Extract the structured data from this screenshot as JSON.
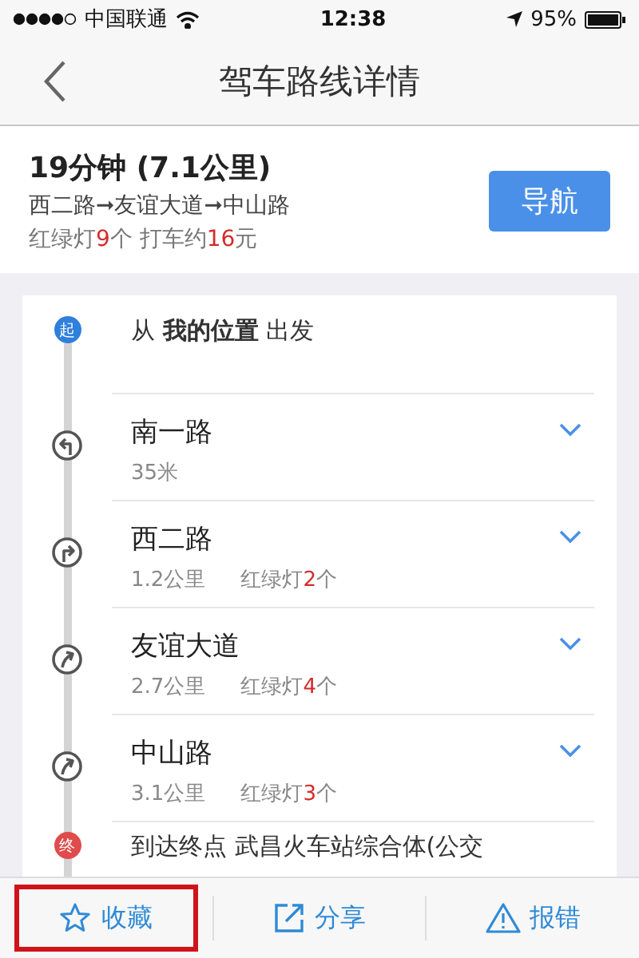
{
  "status_bar": {
    "carrier": "中国联通",
    "time": "12:38",
    "battery": "95%"
  },
  "nav": {
    "title": "驾车路线详情"
  },
  "summary": {
    "duration": "19分钟 (7.1公里)",
    "route": "西二路➞友谊大道➞中山路",
    "info": [
      {
        "text": "红绿灯",
        "highlight": false
      },
      {
        "text": "9",
        "highlight": true
      },
      {
        "text": "个 打车约",
        "highlight": false
      },
      {
        "text": "16",
        "highlight": true
      },
      {
        "text": "元",
        "highlight": false
      }
    ],
    "button": "导航"
  },
  "steps": [
    {
      "kind": "start",
      "badge": "起",
      "text": "从 **我的位置** 出发"
    },
    {
      "kind": "left",
      "road": "南一路",
      "distance": "35米",
      "expandable": true
    },
    {
      "kind": "right",
      "road": "西二路",
      "distance": "1.2公里",
      "lights": [
        {
          "text": "红绿灯",
          "highlight": false
        },
        {
          "text": "2",
          "highlight": true
        },
        {
          "text": "个",
          "highlight": false
        }
      ],
      "expandable": true
    },
    {
      "kind": "bear-right",
      "road": "友谊大道",
      "distance": "2.7公里",
      "lights": [
        {
          "text": "红绿灯",
          "highlight": false
        },
        {
          "text": "4",
          "highlight": true
        },
        {
          "text": "个",
          "highlight": false
        }
      ],
      "expandable": true
    },
    {
      "kind": "bear-right",
      "road": "中山路",
      "distance": "3.1公里",
      "lights": [
        {
          "text": "红绿灯",
          "highlight": false
        },
        {
          "text": "3",
          "highlight": true
        },
        {
          "text": "个",
          "highlight": false
        }
      ],
      "expandable": true
    },
    {
      "kind": "end",
      "badge": "终",
      "text": "到达终点 武昌火车站综合体(公交"
    }
  ],
  "actions": [
    {
      "kind": "star",
      "label": "收藏",
      "highlighted": true
    },
    {
      "kind": "share",
      "label": "分享",
      "highlighted": false
    },
    {
      "kind": "warning",
      "label": "报错",
      "highlighted": false
    }
  ]
}
